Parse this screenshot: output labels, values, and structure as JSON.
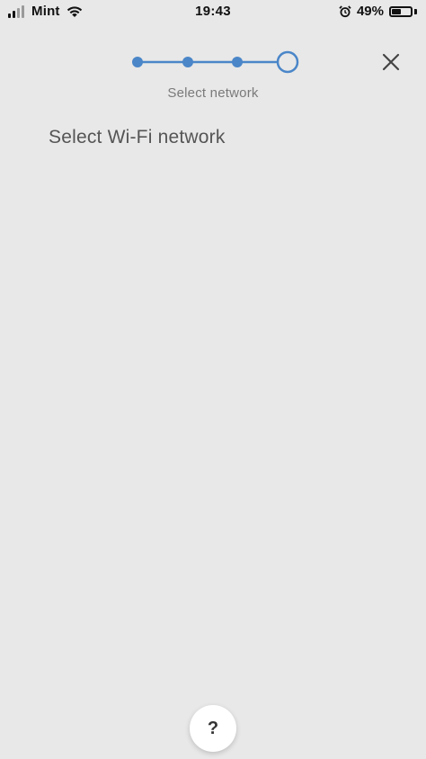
{
  "status_bar": {
    "carrier": "Mint",
    "time": "19:43",
    "battery_percent_text": "49%",
    "battery_level": 0.49,
    "signal_bars_active": 2,
    "signal_bars_total": 4,
    "icons": [
      "signal-icon",
      "wifi-icon",
      "alarm-icon",
      "battery-icon"
    ]
  },
  "stepper": {
    "total_steps": 4,
    "current_step": 4,
    "label": "Select network",
    "accent_color": "#4a86c8"
  },
  "header": {
    "close_icon": "close-icon"
  },
  "main": {
    "title": "Select Wi-Fi network"
  },
  "help": {
    "label": "?",
    "icon": "help-icon"
  },
  "colors": {
    "background": "#e8e8e8",
    "accent": "#4a86c8",
    "title_text": "#555555",
    "subtle_text": "#7a7a7a"
  }
}
